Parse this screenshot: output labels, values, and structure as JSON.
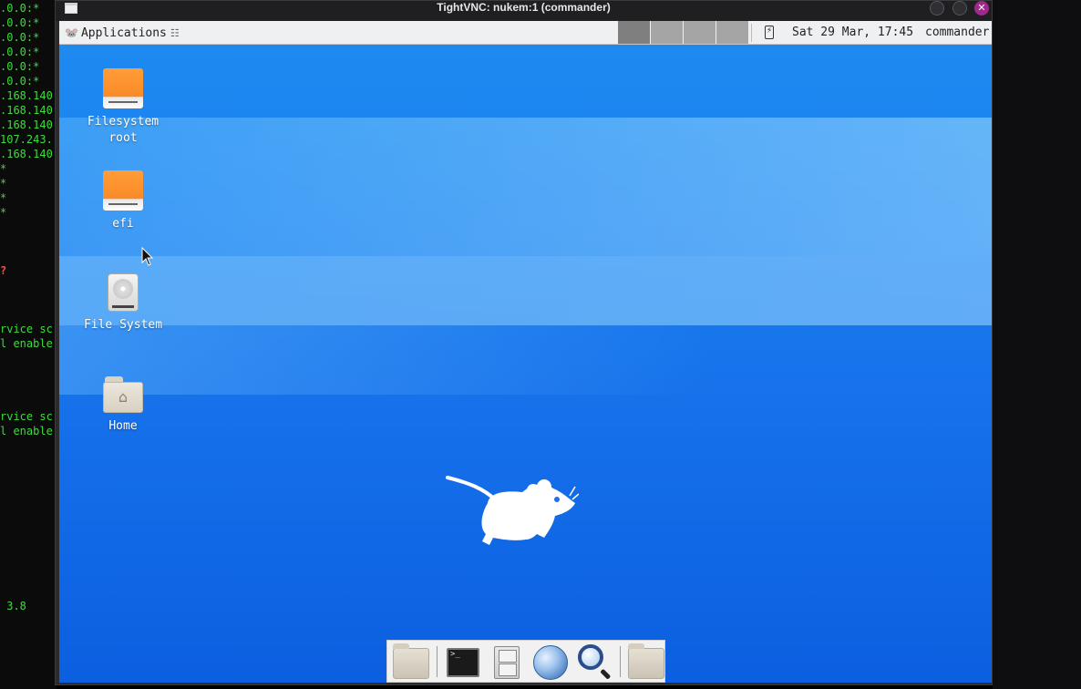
{
  "terminal": {
    "lines": [
      {
        "text": ".0.0:*",
        "red": false
      },
      {
        "text": ".0.0:*",
        "red": false
      },
      {
        "text": ".0.0:*",
        "red": false
      },
      {
        "text": ".0.0:*",
        "red": false
      },
      {
        "text": ".0.0:*",
        "red": false
      },
      {
        "text": ".0.0:*",
        "red": false
      },
      {
        "text": ".168.140",
        "red": false
      },
      {
        "text": ".168.140",
        "red": false
      },
      {
        "text": ".168.140",
        "red": false
      },
      {
        "text": "107.243.",
        "red": false
      },
      {
        "text": ".168.140",
        "red": false
      },
      {
        "text": "*",
        "red": false
      },
      {
        "text": "*",
        "red": false
      },
      {
        "text": "*",
        "red": false
      },
      {
        "text": "*",
        "red": false
      },
      {
        "text": "?",
        "red": true
      },
      {
        "text": "rvice sc",
        "red": false
      },
      {
        "text": "l enable",
        "red": false
      },
      {
        "text": "rvice sc",
        "red": false
      },
      {
        "text": "l enable",
        "red": false
      },
      {
        "text": " 3.8",
        "red": false
      }
    ]
  },
  "window": {
    "title": "TightVNC: nukem:1 (commander)",
    "close_glyph": "✕"
  },
  "panel": {
    "applications_label": "Applications",
    "menu_glyph": "☷",
    "clock": "Sat 29 Mar, 17:45",
    "user": "commander",
    "workspaces": 4,
    "active_workspace": 1,
    "power_glyph": "⚡"
  },
  "desktop_icons": [
    {
      "label": "Filesystem root",
      "icon": "drive-orange-icon"
    },
    {
      "label": "efi",
      "icon": "drive-orange-icon"
    },
    {
      "label": "File System",
      "icon": "harddisk-icon"
    },
    {
      "label": "Home",
      "icon": "home-folder-icon"
    }
  ],
  "dock": {
    "terminal_prompt": ">_",
    "items": [
      "file-manager-icon",
      "terminal-icon",
      "filing-cabinet-icon",
      "web-browser-icon",
      "search-icon",
      "folder-icon"
    ]
  },
  "colors": {
    "close_button": "#a0288c",
    "terminal_text": "#3ddc3d",
    "desktop_blue": "#1b7ef0"
  }
}
